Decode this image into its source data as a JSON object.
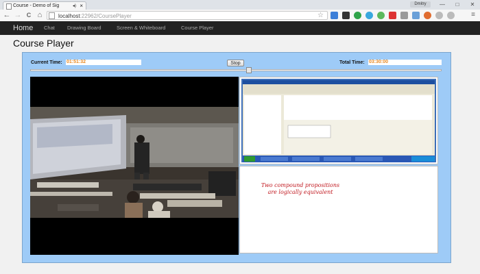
{
  "browser": {
    "tab_title": "Course - Demo of Sig",
    "tab_close": "×",
    "audio_glyph": "◂)",
    "url_host": "localhost",
    "url_port": ":22962",
    "url_path": "/CoursePlayer",
    "back_glyph": "←",
    "forward_glyph": "→",
    "reload_glyph": "C",
    "home_glyph": "⌂",
    "star_glyph": "☆",
    "minimize_glyph": "—",
    "maximize_glyph": "□",
    "close_glyph": "✕",
    "menu_glyph": "≡",
    "user_chip": "Dmitry"
  },
  "navbar": {
    "brand": "Home",
    "items": [
      "Chat",
      "Drawing Board",
      "Screen & Whiteboard",
      "Course Player"
    ]
  },
  "page": {
    "title": "Course Player"
  },
  "player": {
    "current_time_label": "Current Time:",
    "current_time": "01:51:32",
    "stop_label": "Stop",
    "total_time_label": "Total Time:",
    "total_time": "03:30:00",
    "progress_fraction": 0.531
  },
  "whiteboard": {
    "line1": "Two compound propositions",
    "line2": "are logically equivalent"
  },
  "colors": {
    "player_bg": "#9ecbf7",
    "time_value": "#e88a24",
    "navbar_bg": "#222222",
    "ink": "#c0161d"
  }
}
